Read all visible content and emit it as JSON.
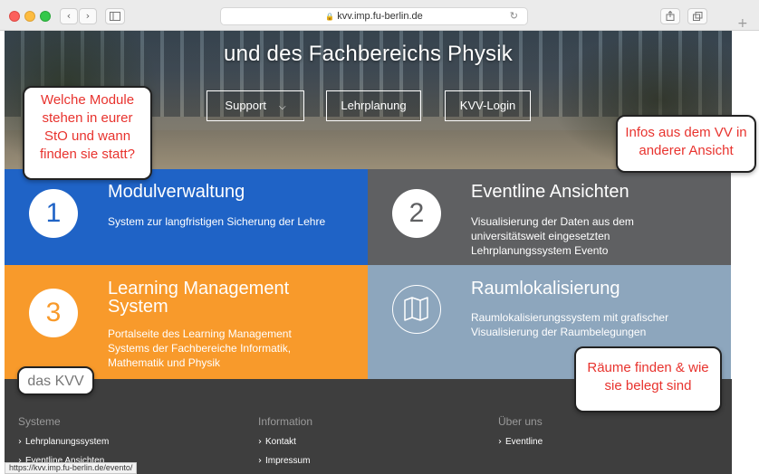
{
  "browser": {
    "url": "kvv.imp.fu-berlin.de",
    "back_icon": "chevron-left-icon",
    "forward_icon": "chevron-right-icon",
    "status_url": "https://kvv.imp.fu-berlin.de/evento/"
  },
  "hero": {
    "title": "und des Fachbereichs Physik",
    "buttons": [
      {
        "label": "Support"
      },
      {
        "label": "Lehrplanung"
      },
      {
        "label": "KVV-Login"
      }
    ]
  },
  "tiles": [
    {
      "number": "1",
      "title": "Modulverwaltung",
      "description": "System zur langfristigen Sicherung der Lehre",
      "color": "#1f63c6"
    },
    {
      "number": "2",
      "title": "Eventline Ansichten",
      "description": "Visualisierung der Daten aus dem universitätsweit eingesetzten Lehrplanungssystem Evento",
      "color": "#5f6062"
    },
    {
      "number": "3",
      "title": "Learning Management System",
      "description": "Portalseite des Learning Management Systems der Fachbereiche Informatik, Mathematik und Physik",
      "color": "#f89a2b"
    },
    {
      "icon": "map-icon",
      "title": "Raumlokalisierung",
      "description": "Raumlokalisierungssystem mit grafischer Visualisierung der Raumbelegungen",
      "color": "#8da6bd"
    }
  ],
  "footer": {
    "columns": [
      {
        "heading": "Systeme",
        "links": [
          "Lehrplanungssystem",
          "Eventline Ansichten"
        ]
      },
      {
        "heading": "Information",
        "links": [
          "Kontakt",
          "Impressum"
        ]
      },
      {
        "heading": "Über uns",
        "links": [
          "Eventline"
        ]
      }
    ]
  },
  "annotations": {
    "modules": "Welche Module stehen in eurer StO und wann finden sie statt?",
    "vv": "Infos aus dem VV in anderer Ansicht",
    "kvv": "das KVV",
    "rooms": "Räume finden & wie sie belegt sind"
  }
}
